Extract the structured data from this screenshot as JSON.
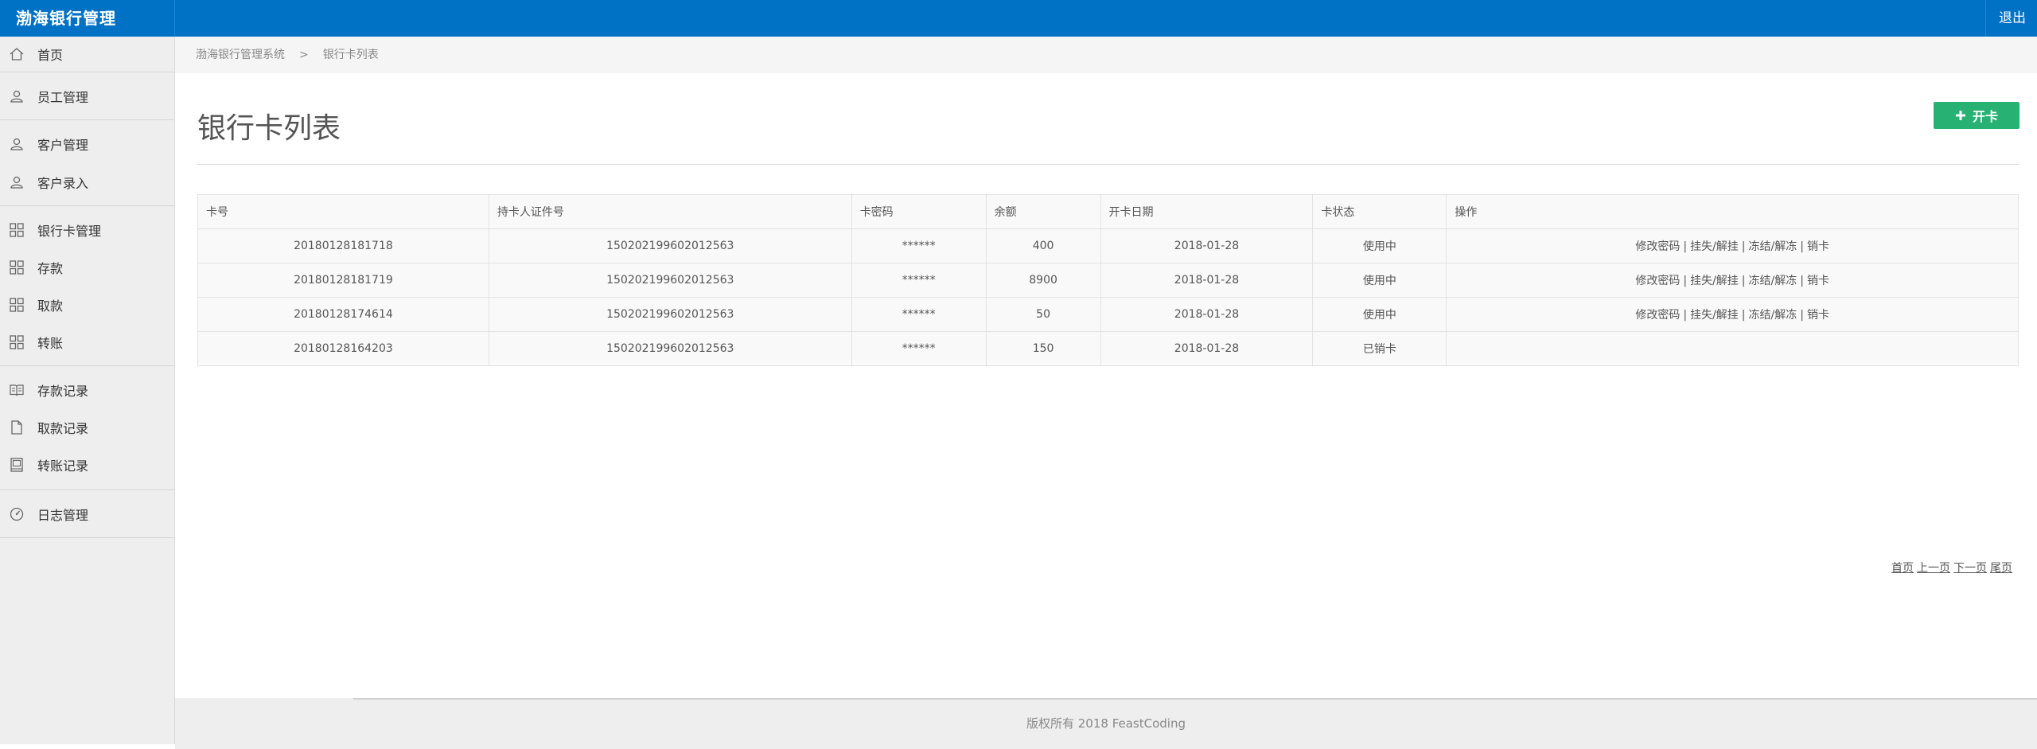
{
  "app": {
    "title": "渤海银行管理",
    "logout_label": "退出"
  },
  "sidebar": {
    "items": [
      {
        "label": "首页",
        "icon": "home-icon"
      },
      {
        "label": "员工管理",
        "icon": "user-icon"
      },
      {
        "label": "客户管理",
        "icon": "user-icon"
      },
      {
        "label": "客户录入",
        "icon": "user-icon"
      },
      {
        "label": "银行卡管理",
        "icon": "grid-icon"
      },
      {
        "label": "存款",
        "icon": "grid-icon"
      },
      {
        "label": "取款",
        "icon": "grid-icon"
      },
      {
        "label": "转账",
        "icon": "grid-icon"
      },
      {
        "label": "存款记录",
        "icon": "book-icon"
      },
      {
        "label": "取款记录",
        "icon": "file-icon"
      },
      {
        "label": "转账记录",
        "icon": "ledger-icon"
      },
      {
        "label": "日志管理",
        "icon": "gauge-icon"
      }
    ]
  },
  "breadcrumb": {
    "root": "渤海银行管理系统",
    "sep": ">",
    "current": "银行卡列表"
  },
  "main": {
    "title": "银行卡列表",
    "open_card_label": "开卡"
  },
  "table": {
    "headers": [
      "卡号",
      "持卡人证件号",
      "卡密码",
      "余额",
      "开卡日期",
      "卡状态",
      "操作"
    ],
    "rows": [
      {
        "card": "20180128181718",
        "id": "150202199602012563",
        "pwd": "******",
        "balance": "400",
        "date": "2018-01-28",
        "status": "使用中",
        "ops": true
      },
      {
        "card": "20180128181719",
        "id": "150202199602012563",
        "pwd": "******",
        "balance": "8900",
        "date": "2018-01-28",
        "status": "使用中",
        "ops": true
      },
      {
        "card": "20180128174614",
        "id": "150202199602012563",
        "pwd": "******",
        "balance": "50",
        "date": "2018-01-28",
        "status": "使用中",
        "ops": true
      },
      {
        "card": "20180128164203",
        "id": "150202199602012563",
        "pwd": "******",
        "balance": "150",
        "date": "2018-01-28",
        "status": "已销卡",
        "ops": false
      }
    ],
    "ops": {
      "change_pwd": "修改密码",
      "loss": "挂失/解挂",
      "freeze": "冻结/解冻",
      "cancel": "销卡",
      "bar": "|"
    }
  },
  "pager": {
    "first": "首页",
    "prev": "上一页",
    "next": "下一页",
    "last": "尾页"
  },
  "footer": {
    "text": "版权所有 2018 FeastCoding"
  },
  "colors": {
    "topbar": "#0072c6",
    "accent_button": "#27b274"
  }
}
